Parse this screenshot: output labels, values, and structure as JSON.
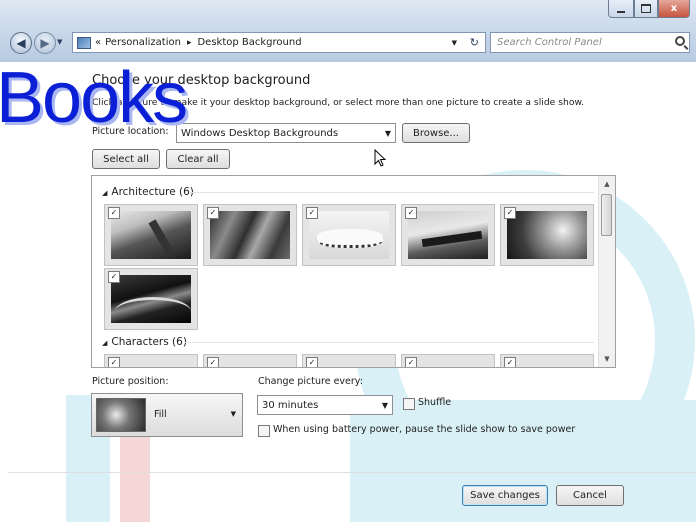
{
  "window": {
    "caption_buttons": [
      "minimize",
      "maximize",
      "close"
    ],
    "close_glyph": "x"
  },
  "nav": {
    "address_sep": "«",
    "breadcrumb": [
      "Personalization",
      "Desktop Background"
    ],
    "crumb_arrow": "▸",
    "refresh_glyph": "↻",
    "search_placeholder": "Search Control Panel"
  },
  "header": {
    "title": "Choose your desktop background",
    "subtitle": "Click a picture to make it your desktop background, or select more than one picture to create a slide show."
  },
  "location": {
    "label": "Picture location:",
    "value": "Windows Desktop Backgrounds",
    "browse_label": "Browse..."
  },
  "selection": {
    "select_all": "Select all",
    "clear_all": "Clear all"
  },
  "gallery": {
    "groups": [
      {
        "title": "Architecture (6)",
        "items": 6
      },
      {
        "title": "Characters (6)",
        "items": 6
      }
    ],
    "check_glyph": "✓"
  },
  "position": {
    "label": "Picture position:",
    "value": "Fill"
  },
  "interval": {
    "label": "Change picture every:",
    "value": "30 minutes",
    "shuffle_label": "Shuffle",
    "battery_label": "When using battery power, pause the slide show to save power"
  },
  "footer": {
    "save_label": "Save changes",
    "cancel_label": "Cancel"
  },
  "watermark": {
    "text": "Books"
  },
  "colors": {
    "accent": "#1f8fbf",
    "watermark_blue": "#0a1fd6",
    "decor_cyan": "#d7f0f5",
    "decor_red": "#f3c9c9"
  }
}
